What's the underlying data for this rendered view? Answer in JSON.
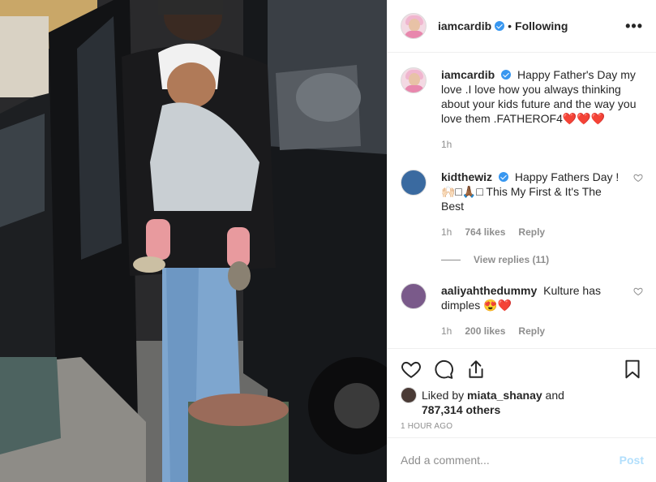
{
  "header": {
    "username": "iamcardib",
    "follow_separator": "•",
    "follow_status": "Following",
    "more_label": "•••"
  },
  "caption": {
    "username": "iamcardib",
    "text": "Happy Father's Day my love .I love how you always thinking about your kids future and the way you love them .FATHEROF4❤️❤️❤️",
    "time": "1h"
  },
  "comments": [
    {
      "username": "kidthewiz",
      "text": "Happy Fathers Day ! 🙌🏻□🙏🏾□ This My First & It's The Best",
      "time": "1h",
      "likes": "764 likes",
      "reply_label": "Reply",
      "view_replies": "View replies (11)"
    },
    {
      "username": "aaliyahthedummy",
      "text": "Kulture has dimples 😍❤️",
      "time": "1h",
      "likes": "200 likes",
      "reply_label": "Reply"
    }
  ],
  "likes": {
    "prefix": "Liked by",
    "user": "miata_shanay",
    "joiner": "and",
    "others": "787,314 others"
  },
  "timestamp": "1 HOUR AGO",
  "add_comment": {
    "placeholder": "Add a comment...",
    "post_label": "Post"
  },
  "colors": {
    "verified": "#3897f0",
    "muted": "#8e8e8e",
    "post_disabled": "#b2dffc"
  },
  "icons": [
    "heart-icon",
    "comment-icon",
    "share-icon",
    "bookmark-icon",
    "verified-icon",
    "more-icon"
  ]
}
